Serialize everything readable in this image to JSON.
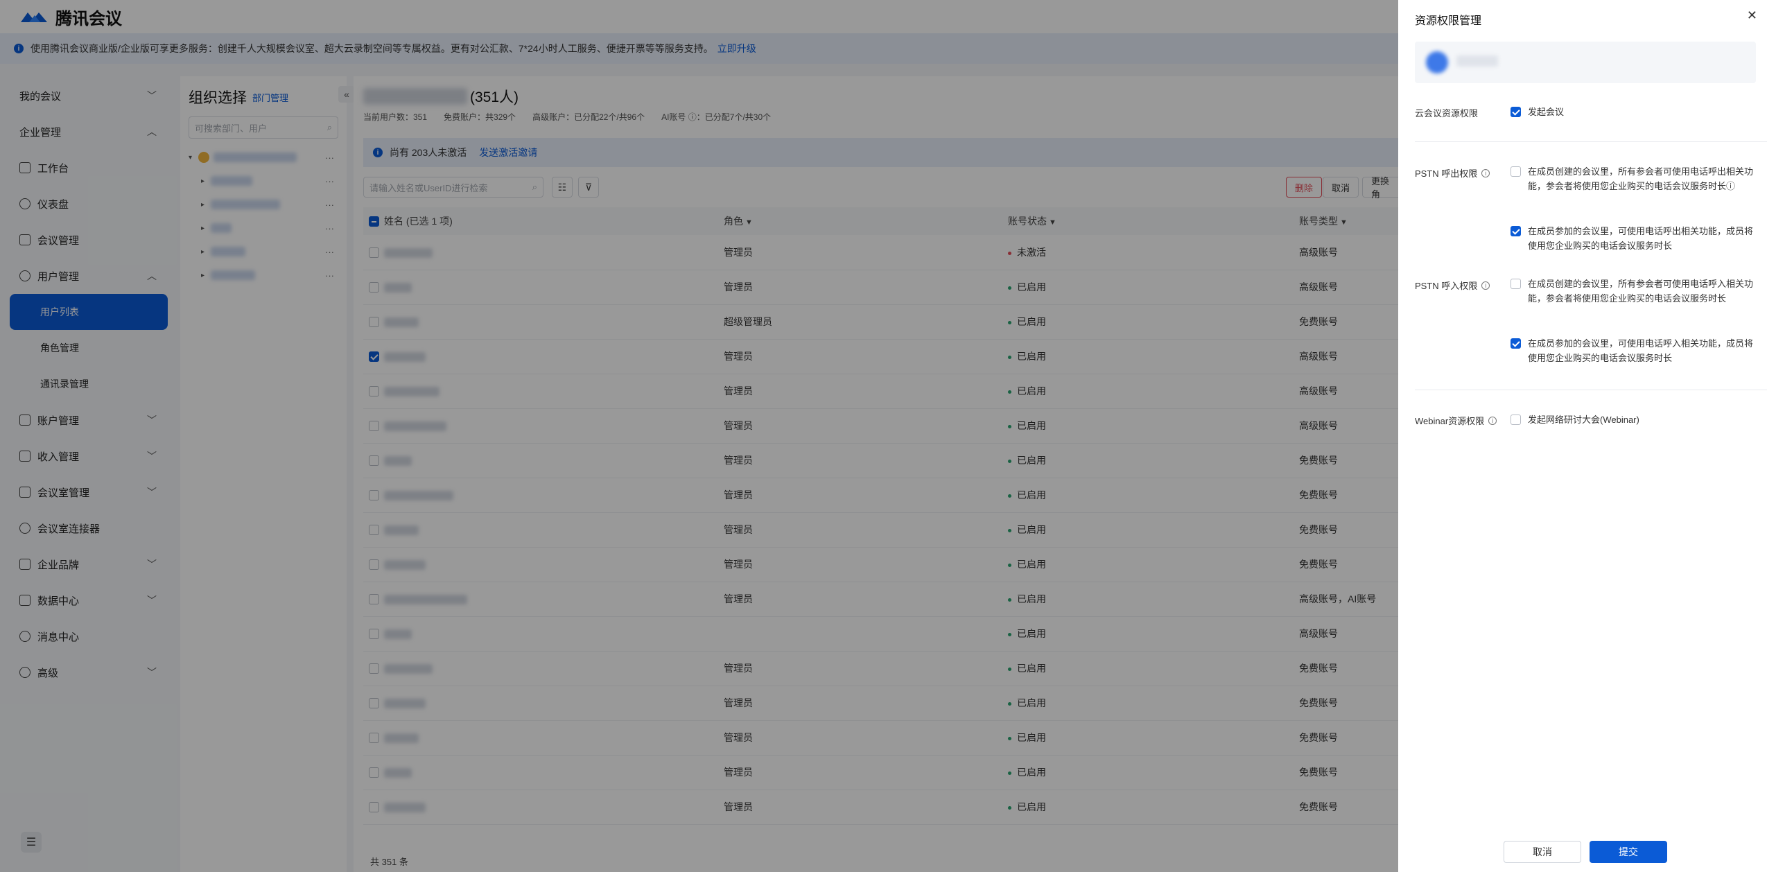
{
  "app": {
    "name": "腾讯会议"
  },
  "banner": {
    "text": "使用腾讯会议商业版/企业版可享更多服务：创建千人大规模会议室、超大云录制空间等专属权益。更有对公汇款、7*24小时人工服务、便捷开票等等服务支持。",
    "link": "立即升级"
  },
  "sidebar": {
    "items": [
      {
        "label": "我的会议",
        "chevron": "﹀"
      },
      {
        "label": "企业管理",
        "chevron": "︿"
      },
      {
        "label": "工作台"
      },
      {
        "label": "仪表盘"
      },
      {
        "label": "会议管理"
      },
      {
        "label": "用户管理",
        "chevron": "︿"
      },
      {
        "label": "用户列表"
      },
      {
        "label": "角色管理"
      },
      {
        "label": "通讯录管理"
      },
      {
        "label": "账户管理",
        "chevron": "﹀"
      },
      {
        "label": "收入管理",
        "chevron": "﹀"
      },
      {
        "label": "会议室管理",
        "chevron": "﹀"
      },
      {
        "label": "会议室连接器"
      },
      {
        "label": "企业品牌",
        "chevron": "﹀"
      },
      {
        "label": "数据中心",
        "chevron": "﹀"
      },
      {
        "label": "消息中心"
      },
      {
        "label": "高级",
        "chevron": "﹀"
      }
    ]
  },
  "org": {
    "title": "组织选择",
    "dept_link": "部门管理",
    "search_placeholder": "可搜索部门、用户"
  },
  "main": {
    "count": "(351人)",
    "stats": [
      "当前用户数：351",
      "免费账户：共329个",
      "高级账户：已分配22个/共96个",
      "AI账号 ⓘ：已分配7个/共30个"
    ],
    "notice": "尚有 203人未激活",
    "notice_link": "发送激活邀请",
    "search_placeholder": "请输入姓名或UserID进行检索",
    "btn_delete": "删除",
    "btn_cancel": "取消",
    "btn_change": "更换角",
    "columns": {
      "name": "姓名 (已选 1 项)",
      "role": "角色",
      "status": "账号状态",
      "type": "账号类型"
    },
    "rows": [
      {
        "checked": false,
        "role": "管理员",
        "status": "未激活",
        "status_color": "#e34d59",
        "type": "高级账号"
      },
      {
        "checked": false,
        "role": "管理员",
        "status": "已启用",
        "status_color": "#2ba471",
        "type": "高级账号"
      },
      {
        "checked": false,
        "role": "超级管理员",
        "status": "已启用",
        "status_color": "#2ba471",
        "type": "免费账号"
      },
      {
        "checked": true,
        "role": "管理员",
        "status": "已启用",
        "status_color": "#2ba471",
        "type": "高级账号"
      },
      {
        "checked": false,
        "role": "管理员",
        "status": "已启用",
        "status_color": "#2ba471",
        "type": "高级账号"
      },
      {
        "checked": false,
        "role": "管理员",
        "status": "已启用",
        "status_color": "#2ba471",
        "type": "高级账号"
      },
      {
        "checked": false,
        "role": "管理员",
        "status": "已启用",
        "status_color": "#2ba471",
        "type": "免费账号"
      },
      {
        "checked": false,
        "role": "管理员",
        "status": "已启用",
        "status_color": "#2ba471",
        "type": "免费账号"
      },
      {
        "checked": false,
        "role": "管理员",
        "status": "已启用",
        "status_color": "#2ba471",
        "type": "免费账号"
      },
      {
        "checked": false,
        "role": "管理员",
        "status": "已启用",
        "status_color": "#2ba471",
        "type": "免费账号"
      },
      {
        "checked": false,
        "role": "管理员",
        "status": "已启用",
        "status_color": "#2ba471",
        "type": "高级账号，AI账号"
      },
      {
        "checked": false,
        "role": "",
        "status": "已启用",
        "status_color": "#2ba471",
        "type": "高级账号"
      },
      {
        "checked": false,
        "role": "管理员",
        "status": "已启用",
        "status_color": "#2ba471",
        "type": "免费账号"
      },
      {
        "checked": false,
        "role": "管理员",
        "status": "已启用",
        "status_color": "#2ba471",
        "type": "免费账号"
      },
      {
        "checked": false,
        "role": "管理员",
        "status": "已启用",
        "status_color": "#2ba471",
        "type": "免费账号"
      },
      {
        "checked": false,
        "role": "管理员",
        "status": "已启用",
        "status_color": "#2ba471",
        "type": "免费账号"
      },
      {
        "checked": false,
        "role": "管理员",
        "status": "已启用",
        "status_color": "#2ba471",
        "type": "免费账号"
      }
    ],
    "total": "共 351 条"
  },
  "drawer": {
    "title": "资源权限管理",
    "cloud_label": "云会议资源权限",
    "cloud_opt": "发起会议",
    "pstn_out_label": "PSTN 呼出权限",
    "pstn_out_opt1": "在成员创建的会议里，所有参会者可使用电话呼出相关功能，参会者将使用您企业购买的电话会议服务时长ⓘ",
    "pstn_out_opt2": "在成员参加的会议里，可使用电话呼出相关功能，成员将使用您企业购买的电话会议服务时长",
    "pstn_in_label": "PSTN 呼入权限",
    "pstn_in_opt1": "在成员创建的会议里，所有参会者可使用电话呼入相关功能，参会者将使用您企业购买的电话会议服务时长",
    "pstn_in_opt2": "在成员参加的会议里，可使用电话呼入相关功能，成员将使用您企业购买的电话会议服务时长",
    "webinar_label": "Webinar资源权限",
    "webinar_opt": "发起网络研讨大会(Webinar)",
    "cancel": "取消",
    "submit": "提交"
  },
  "colors": {
    "accent": "#0b5bd6",
    "danger": "#e34d59",
    "success": "#2ba471"
  }
}
